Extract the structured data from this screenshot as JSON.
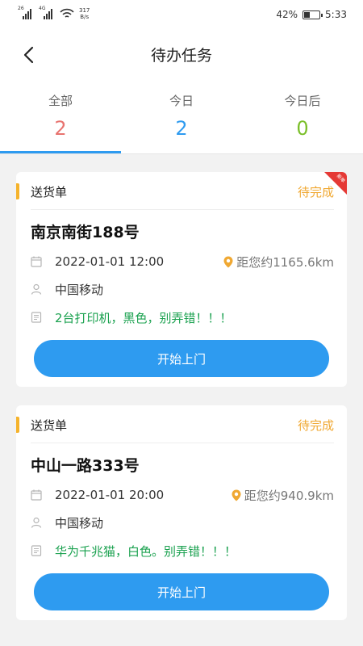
{
  "status_bar": {
    "signal1_tag": "26",
    "signal2_tag": "4G",
    "speed_value": "317",
    "speed_unit": "B/s",
    "battery_percent": "42%",
    "battery_level": 0.42,
    "time": "5:33"
  },
  "header": {
    "title": "待办任务",
    "back_icon": "chevron-left-icon"
  },
  "tabs": [
    {
      "label": "全部",
      "count": "2",
      "color": "#e8736f",
      "active": true
    },
    {
      "label": "今日",
      "count": "2",
      "color": "#2e9bf0",
      "active": false
    },
    {
      "label": "今日后",
      "count": "0",
      "color": "#7bbf2a",
      "active": false
    }
  ],
  "colors": {
    "primary": "#2e9bf0",
    "pending": "#f0a832",
    "note": "#1aa14f",
    "accent_bar": "#f5b32c",
    "badge": "#e53935"
  },
  "tasks": [
    {
      "type": "送货单",
      "status": "待完成",
      "address": "南京南街188号",
      "datetime": "2022-01-01 12:00",
      "distance": "距您约1165.6km",
      "contact": "中国移动",
      "note": "2台打印机，黑色，别弄错！！！",
      "button": "开始上门",
      "has_badge": true,
      "badge_text": "新单"
    },
    {
      "type": "送货单",
      "status": "待完成",
      "address": "中山一路333号",
      "datetime": "2022-01-01 20:00",
      "distance": "距您约940.9km",
      "contact": "中国移动",
      "note": "华为千兆猫，白色。别弄错！！！",
      "button": "开始上门",
      "has_badge": false
    }
  ]
}
